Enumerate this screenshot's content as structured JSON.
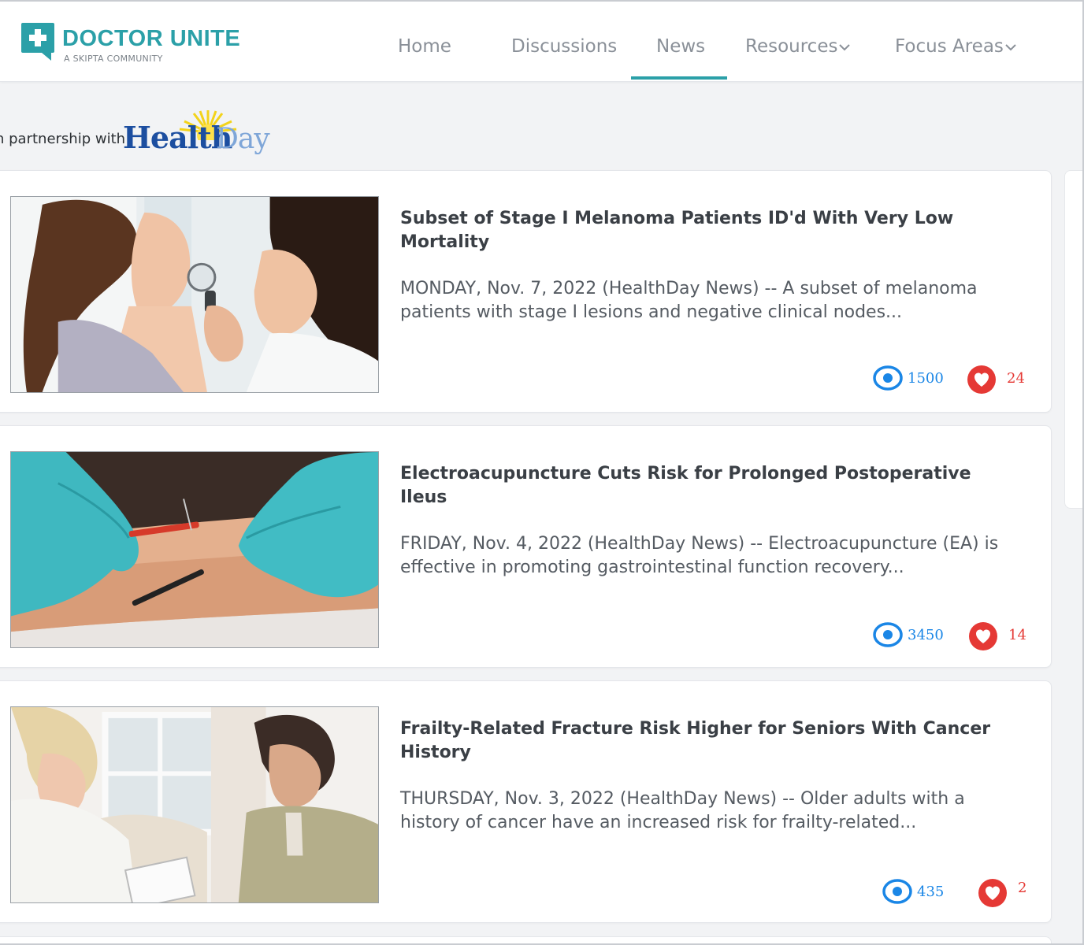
{
  "brand": {
    "title": "DOCTOR UNITE",
    "subtitle": "A SKIPTA COMMUNITY",
    "accent": "#2ba0a8"
  },
  "nav": {
    "items": [
      {
        "label": "Home",
        "icon": null
      },
      {
        "label": "Discussions",
        "icon": null
      },
      {
        "label": "News",
        "icon": null
      },
      {
        "label": "Resources",
        "icon": "chevron-down-icon"
      },
      {
        "label": "Focus Areas",
        "icon": "chevron-down-icon"
      }
    ],
    "active": "News"
  },
  "partner": {
    "text": "n partnership with",
    "logo_health": "Health",
    "logo_day": "Day"
  },
  "articles": [
    {
      "title": "Subset of Stage I Melanoma Patients ID'd With Very Low Mortality",
      "summary": "MONDAY, Nov. 7, 2022 (HealthDay News) -- A subset of melanoma patients with stage I lesions and negative clinical nodes...",
      "views": "1500",
      "likes": "24",
      "image": "doctor-examining-patient-skin-photo"
    },
    {
      "title": "Electroacupuncture Cuts Risk for Prolonged Postoperative Ileus",
      "summary": "FRIDAY, Nov. 4, 2022 (HealthDay News) -- Electroacupuncture (EA) is effective in promoting gastrointestinal function recovery...",
      "views": "3450",
      "likes": "14",
      "image": "gloved-hands-acupuncture-photo"
    },
    {
      "title": "Frailty-Related Fracture Risk Higher for Seniors With Cancer History",
      "summary": "THURSDAY, Nov. 3, 2022 (HealthDay News) -- Older adults with a history of cancer have an increased risk for frailty-related...",
      "views": "435",
      "likes": "2",
      "image": "doctor-with-senior-patient-photo"
    }
  ],
  "colors": {
    "views": "#1a86e6",
    "likes": "#e53935"
  }
}
